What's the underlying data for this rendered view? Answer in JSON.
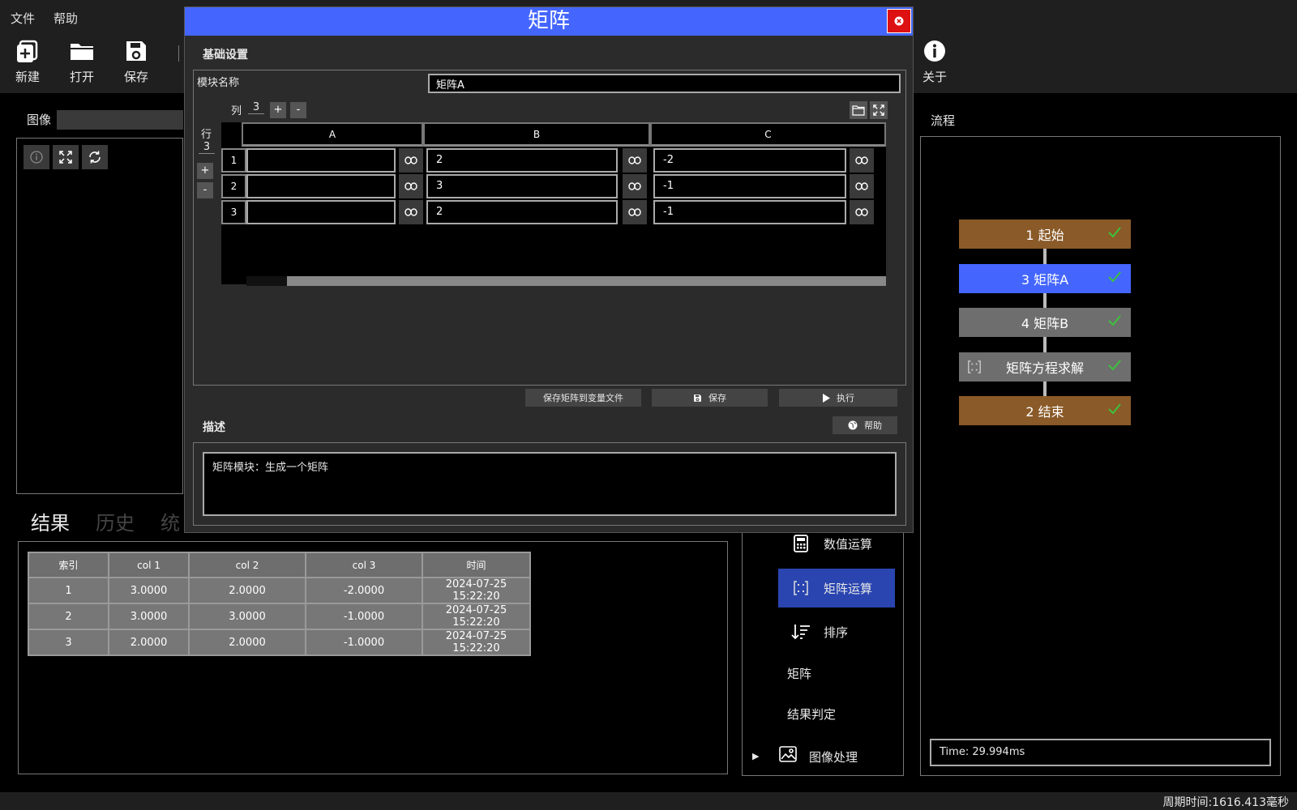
{
  "menu": {
    "file": "文件",
    "help": "帮助"
  },
  "toolbar": {
    "new": "新建",
    "open": "打开",
    "save": "保存",
    "about": "关于"
  },
  "image_panel": {
    "title": "图像"
  },
  "results": {
    "tabs": [
      "结果",
      "历史",
      "统"
    ],
    "headers": [
      "索引",
      "col 1",
      "col 2",
      "col 3",
      "时间"
    ],
    "rows": [
      [
        "1",
        "3.0000",
        "2.0000",
        "-2.0000",
        "2024-07-25 15:22:20"
      ],
      [
        "2",
        "3.0000",
        "3.0000",
        "-1.0000",
        "2024-07-25 15:22:20"
      ],
      [
        "3",
        "2.0000",
        "2.0000",
        "-1.0000",
        "2024-07-25 15:22:20"
      ]
    ]
  },
  "library": {
    "items": [
      "数值运算",
      "矩阵运算",
      "排序",
      "矩阵",
      "结果判定",
      "图像处理"
    ]
  },
  "flow": {
    "title": "流程",
    "nodes": [
      "1 起始",
      "3 矩阵A",
      "4 矩阵B",
      "矩阵方程求解",
      "2 结束"
    ],
    "time": "Time: 29.994ms",
    "colors": {
      "start_end": "#8a5a28",
      "active": "#4466ff",
      "normal": "#6e6e6e",
      "check": "#3cc23c"
    }
  },
  "status": {
    "cycle": "周期时间:1616.413毫秒"
  },
  "dialog": {
    "title": "矩阵",
    "basic_section": "基础设置",
    "module_name_label": "模块名称",
    "module_name_value": "矩阵A",
    "cols_label": "列",
    "cols_value": "3",
    "rows_label": "行",
    "rows_value": "3",
    "plus": "+",
    "minus": "-",
    "columns": [
      "A",
      "B",
      "C"
    ],
    "row_numbers": [
      "1",
      "2",
      "3"
    ],
    "matrix": [
      [
        "",
        "2",
        "-2"
      ],
      [
        "",
        "3",
        "-1"
      ],
      [
        "",
        "2",
        "-1"
      ]
    ],
    "btn_save_to_var": "保存矩阵到变量文件",
    "btn_save": "保存",
    "btn_run": "执行",
    "desc_section": "描述",
    "btn_help": "帮助",
    "description": "矩阵模块：生成一个矩阵"
  }
}
